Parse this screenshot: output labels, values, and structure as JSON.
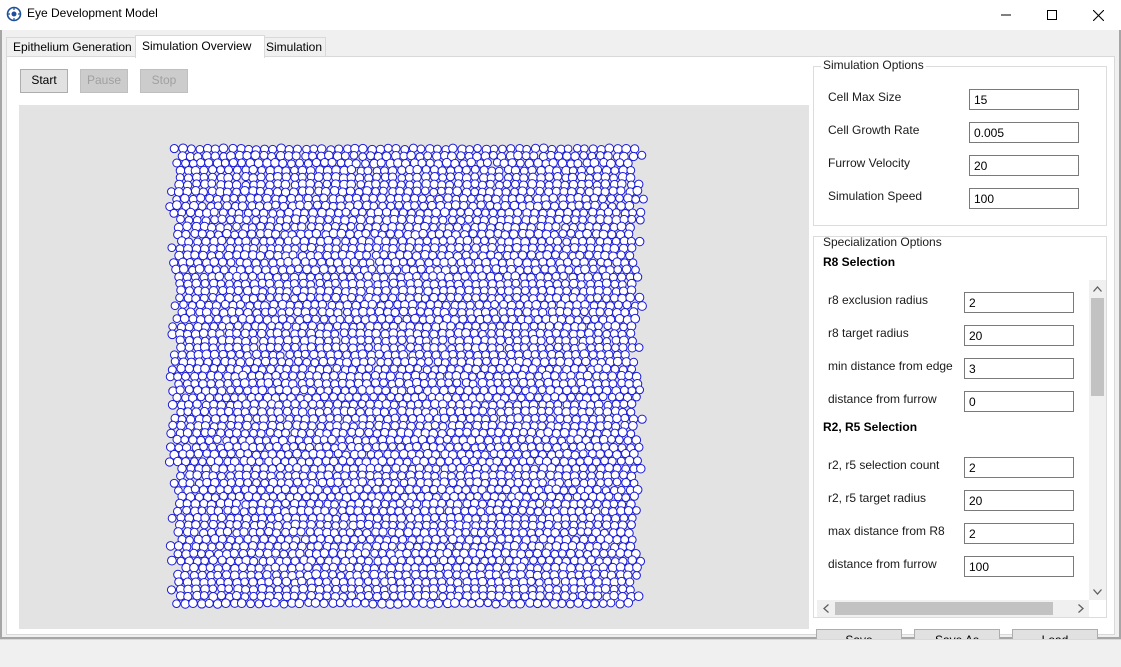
{
  "window": {
    "title": "Eye Development Model",
    "icon": "app-logo-icon",
    "controls": [
      "minimize-icon",
      "maximize-icon",
      "close-icon"
    ]
  },
  "tabs": [
    {
      "label": "Epithelium Generation",
      "active": false
    },
    {
      "label": "Simulation Overview",
      "active": true
    },
    {
      "label": "Simulation",
      "active": false
    }
  ],
  "toolbar": {
    "start_label": "Start",
    "pause_label": "Pause",
    "stop_label": "Stop"
  },
  "canvas": {
    "cell_color": "#1a1ad6",
    "background": "#e3e3e3"
  },
  "simulation_options": {
    "title": "Simulation Options",
    "fields": [
      {
        "label": "Cell Max Size",
        "value": "15"
      },
      {
        "label": "Cell Growth Rate",
        "value": "0.005"
      },
      {
        "label": "Furrow Velocity",
        "value": "20"
      },
      {
        "label": "Simulation Speed",
        "value": "100"
      }
    ]
  },
  "specialization_options": {
    "title": "Specialization Options",
    "r8": {
      "heading": "R8 Selection",
      "fields": [
        {
          "label": "r8 exclusion radius",
          "value": "2"
        },
        {
          "label": "r8 target radius",
          "value": "20"
        },
        {
          "label": "min distance from edge",
          "value": "3"
        },
        {
          "label": "distance from furrow",
          "value": "0"
        }
      ]
    },
    "r25": {
      "heading": "R2, R5 Selection",
      "fields": [
        {
          "label": "r2, r5 selection count",
          "value": "2"
        },
        {
          "label": "r2, r5 target radius",
          "value": "20"
        },
        {
          "label": "max distance from R8",
          "value": "2"
        },
        {
          "label": "distance from furrow",
          "value": "100"
        }
      ]
    }
  },
  "bottom_buttons": {
    "save_label": "Save",
    "save_as_label": "Save As",
    "load_label": "Load"
  }
}
